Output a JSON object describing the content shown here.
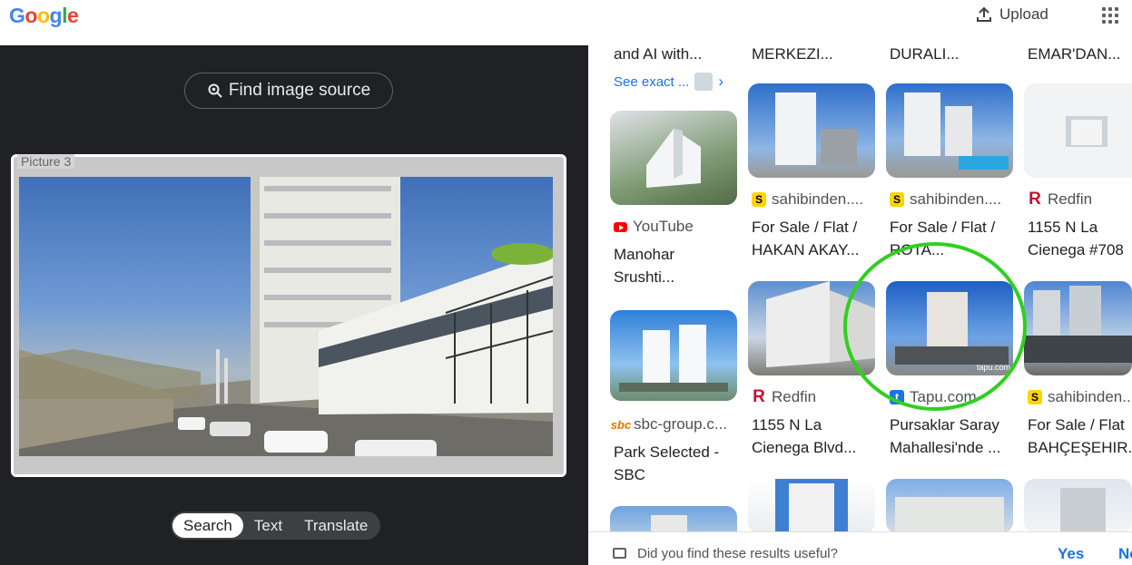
{
  "header": {
    "logo_letters": [
      {
        "ch": "G",
        "color": "#4285f4"
      },
      {
        "ch": "o",
        "color": "#ea4335"
      },
      {
        "ch": "o",
        "color": "#fbbc05"
      },
      {
        "ch": "g",
        "color": "#4285f4"
      },
      {
        "ch": "l",
        "color": "#34a853"
      },
      {
        "ch": "e",
        "color": "#ea4335"
      }
    ],
    "upload_label": "Upload"
  },
  "lens": {
    "find_source_label": "Find image source",
    "image_label": "Picture 3",
    "tabs": [
      {
        "label": "Search",
        "active": true
      },
      {
        "label": "Text",
        "active": false
      },
      {
        "label": "Translate",
        "active": false
      }
    ]
  },
  "results": {
    "top_row": [
      {
        "title": "and AI with..."
      },
      {
        "title": "MERKEZI..."
      },
      {
        "title": "DURALI..."
      },
      {
        "title": "EMAR'DAN..."
      }
    ],
    "see_exact_label": "See exact ...",
    "cards": [
      {
        "source": "YouTube",
        "favicon": "youtube",
        "title": "Manohar\nSrushti..."
      },
      {
        "source": "sahibinden....",
        "favicon": "s",
        "title": "For Sale / Flat /\nHAKAN AKAY..."
      },
      {
        "source": "sahibinden....",
        "favicon": "s",
        "title": "For Sale / Flat /\nROTA..."
      },
      {
        "source": "Redfin",
        "favicon": "r",
        "title": "1155 N La\nCienega #708"
      },
      {
        "source": "sbc-group.c...",
        "favicon": "sbc",
        "title": "Park Selected -\nSBC"
      },
      {
        "source": "Redfin",
        "favicon": "r",
        "title": "1155 N La\nCienega Blvd..."
      },
      {
        "source": "Tapu.com",
        "favicon": "t",
        "title": "Pursaklar Saray\nMahallesi'nde ..."
      },
      {
        "source": "sahibinden....",
        "favicon": "s",
        "title": "For Sale / Flat\nBAHÇEŞEHIR..."
      }
    ],
    "watermark": "tapu.com"
  },
  "feedback": {
    "question": "Did you find these results useful?",
    "yes_label": "Yes",
    "no_label": "No"
  },
  "colors": {
    "annotation_circle": "#2fd020",
    "link_blue": "#1a73e8"
  }
}
